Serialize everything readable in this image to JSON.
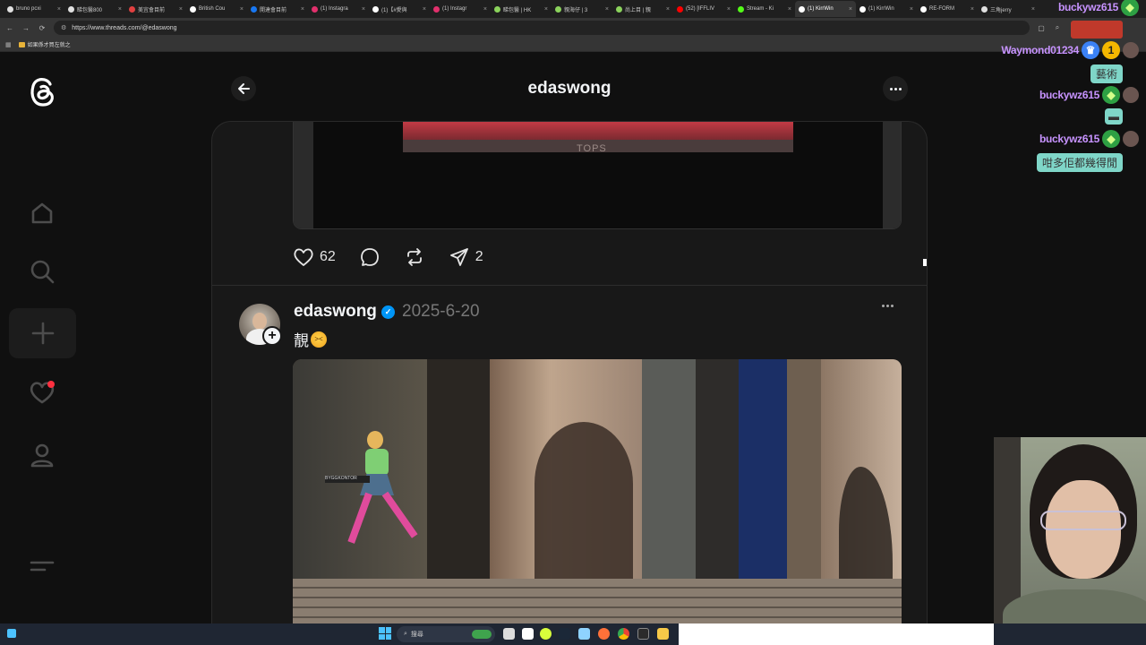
{
  "browser": {
    "tabs": [
      {
        "label": "bruno pcxi",
        "color": "#e0e0e0"
      },
      {
        "label": "睇包醫800",
        "color": "#e0e0e0"
      },
      {
        "label": "美宜會目前",
        "color": "#e04040"
      },
      {
        "label": "British Cou",
        "color": "#ffffff"
      },
      {
        "label": "開達會目前",
        "color": "#1877f2"
      },
      {
        "label": "(1) Instagra",
        "color": "#e1306c"
      },
      {
        "label": "(1)【#愛與",
        "color": "#ffffff"
      },
      {
        "label": "(1) Instagr",
        "color": "#e1306c"
      },
      {
        "label": "睇包醫 | HK",
        "color": "#8bd35c"
      },
      {
        "label": "親海仔 | 3",
        "color": "#8bd35c"
      },
      {
        "label": "尚上目 | 親",
        "color": "#8bd35c"
      },
      {
        "label": "(52) [IFFLIV",
        "color": "#ff0000"
      },
      {
        "label": "Stream - Ki",
        "color": "#53fc18"
      },
      {
        "label": "(1) KirrWin",
        "color": "#ffffff"
      },
      {
        "label": "(1) KirrWin",
        "color": "#ffffff"
      },
      {
        "label": "RE-FORM",
        "color": "#ffffff"
      },
      {
        "label": "三角jerry",
        "color": "#e0e0e0"
      }
    ],
    "active_tab_index": 13,
    "url": "https://www.threads.com/@edaswong",
    "bookmark": "如果係才買左就之"
  },
  "threads": {
    "header_title": "edaswong",
    "post1": {
      "likes": "62",
      "shares": "2"
    },
    "post2": {
      "username": "edaswong",
      "date": "2025-6-20",
      "text": "靚",
      "emoji": "laughing-face-emoji",
      "image_sign_text": "TOPS",
      "image_caption_sign": "BYGGKONTOR"
    }
  },
  "chat": {
    "messages": [
      {
        "user": "buckywz615",
        "badge": "green-diamond"
      },
      {
        "user": "Waymond01234",
        "badge": "crown-gold-1"
      },
      {
        "text": "藝術"
      },
      {
        "user": "buckywz615",
        "badge": "green-diamond"
      },
      {
        "user": "buckywz615",
        "badge": "green-diamond"
      },
      {
        "text": "咁多佢都幾得閒"
      }
    ]
  },
  "taskbar": {
    "search_placeholder": "搜尋"
  },
  "colors": {
    "page_bg": "#101010",
    "card_bg": "#181818",
    "verified": "#0095f6",
    "chat_name": "#c793ff",
    "chat_bubble": "#7fd6c8"
  }
}
